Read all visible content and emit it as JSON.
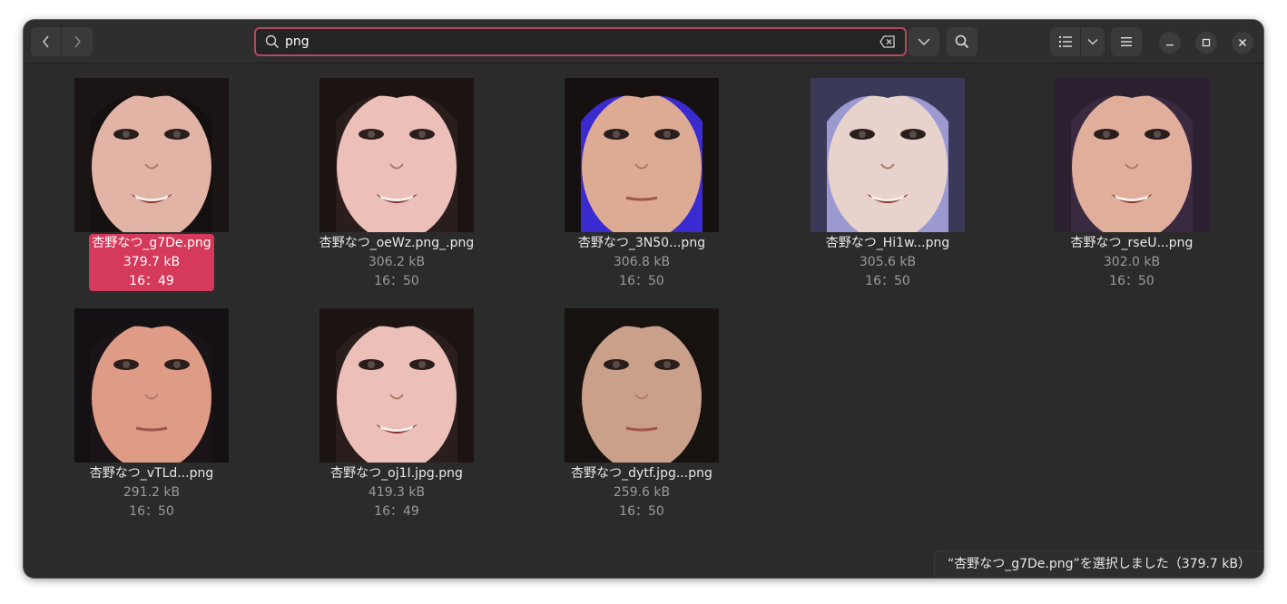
{
  "search": {
    "query": "png"
  },
  "files": [
    {
      "name": "杏野なつ_g7De.png",
      "size": "379.7 kB",
      "time": "16：49",
      "selected": true,
      "thumb": {
        "bg": "#141010",
        "skin": "#e2b4a6",
        "hair": "#1a1414",
        "mouth": "open"
      }
    },
    {
      "name": "杏野なつ_oeWz.png_.png",
      "size": "306.2 kB",
      "time": "16：50",
      "selected": false,
      "thumb": {
        "bg": "#2a1e1c",
        "skin": "#ecc0b8",
        "hair": "#1c1412",
        "mouth": "open"
      }
    },
    {
      "name": "杏野なつ_3N50...png",
      "size": "306.8 kB",
      "time": "16：50",
      "selected": false,
      "thumb": {
        "bg": "#3a2bd0",
        "skin": "#ddab94",
        "hair": "#161010",
        "mouth": "closed"
      }
    },
    {
      "name": "杏野なつ_Hi1w...png",
      "size": "305.6 kB",
      "time": "16：50",
      "selected": false,
      "thumb": {
        "bg": "#9a9ad0",
        "skin": "#e8d2cc",
        "hair": "#3a3a58",
        "mouth": "open"
      }
    },
    {
      "name": "杏野なつ_rseU...png",
      "size": "302.0 kB",
      "time": "16：50",
      "selected": false,
      "thumb": {
        "bg": "#3a2a40",
        "skin": "#e2ae9c",
        "hair": "#2a2030",
        "mouth": "open"
      }
    },
    {
      "name": "杏野なつ_vTLd...png",
      "size": "291.2 kB",
      "time": "16：50",
      "selected": false,
      "thumb": {
        "bg": "#1a1418",
        "skin": "#de9c86",
        "hair": "#141014",
        "mouth": "closed"
      }
    },
    {
      "name": "杏野なつ_oj1I.jpg.png",
      "size": "419.3 kB",
      "time": "16：49",
      "selected": false,
      "thumb": {
        "bg": "#2a1e1c",
        "skin": "#ecc0b8",
        "hair": "#1c1412",
        "mouth": "open"
      }
    },
    {
      "name": "杏野なつ_dytf.jpg...png",
      "size": "259.6 kB",
      "time": "16：50",
      "selected": false,
      "thumb": {
        "bg": "#161210",
        "skin": "#caa08a",
        "hair": "#181210",
        "mouth": "closed"
      }
    }
  ],
  "status": {
    "text": "“杏野なつ_g7De.png”を選択しました（379.7 kB）"
  },
  "colors": {
    "accent": "#d5395b",
    "search_border": "#b04a5e",
    "window_bg": "#2b2b2b"
  },
  "icons": {
    "back": "chevron-left-icon",
    "forward": "chevron-right-icon",
    "search": "search-icon",
    "clear": "clear-text-icon",
    "dropdown": "chevron-down-icon",
    "list_view": "list-view-icon",
    "menu": "hamburger-menu-icon",
    "minimize": "minimize-icon",
    "maximize": "maximize-icon",
    "close": "close-icon"
  }
}
